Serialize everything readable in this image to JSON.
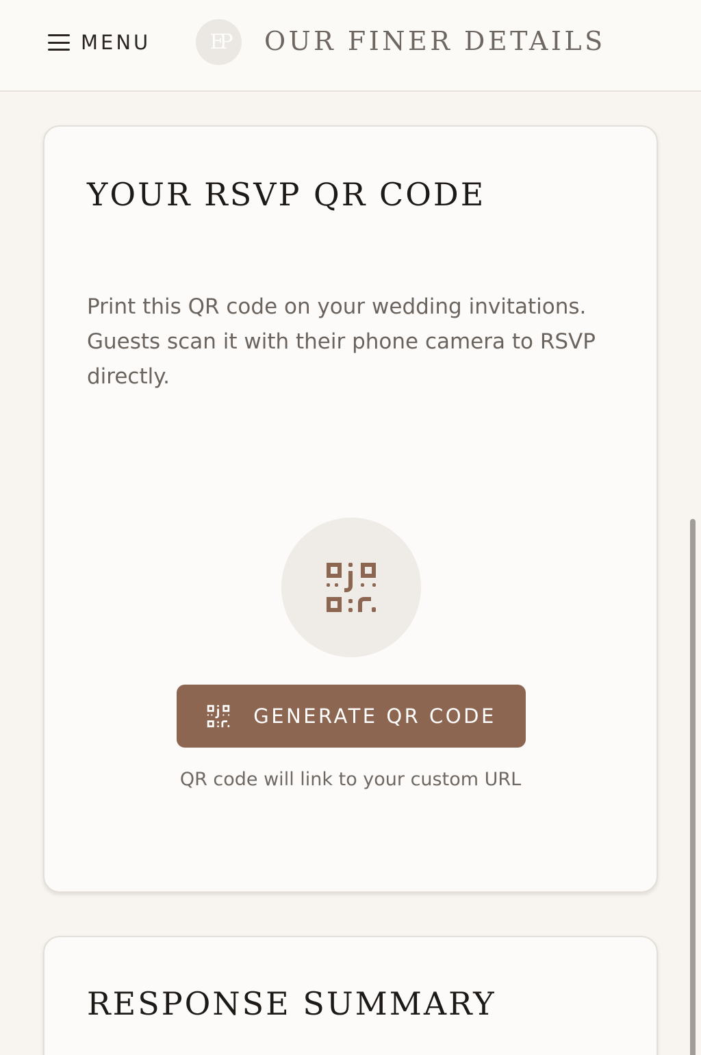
{
  "header": {
    "menu_label": "MENU",
    "logo_monogram": "EP",
    "brand_name": "OUR FINER DETAILS"
  },
  "qr_card": {
    "title": "YOUR RSVP QR CODE",
    "description": "Print this QR code on your wedding invitations. Guests scan it with their phone camera to RSVP directly.",
    "placeholder_icon": "qr-code-icon",
    "button_icon": "qr-code-icon",
    "button_label": "GENERATE QR CODE",
    "hint": "QR code will link to your custom URL"
  },
  "summary_card": {
    "title": "RESPONSE SUMMARY"
  },
  "colors": {
    "page_background": "#f8f5f1",
    "card_background": "#fdfbf9",
    "accent_brown": "#8d6652",
    "text_dark": "#1d1916",
    "text_muted": "#6b645e"
  }
}
